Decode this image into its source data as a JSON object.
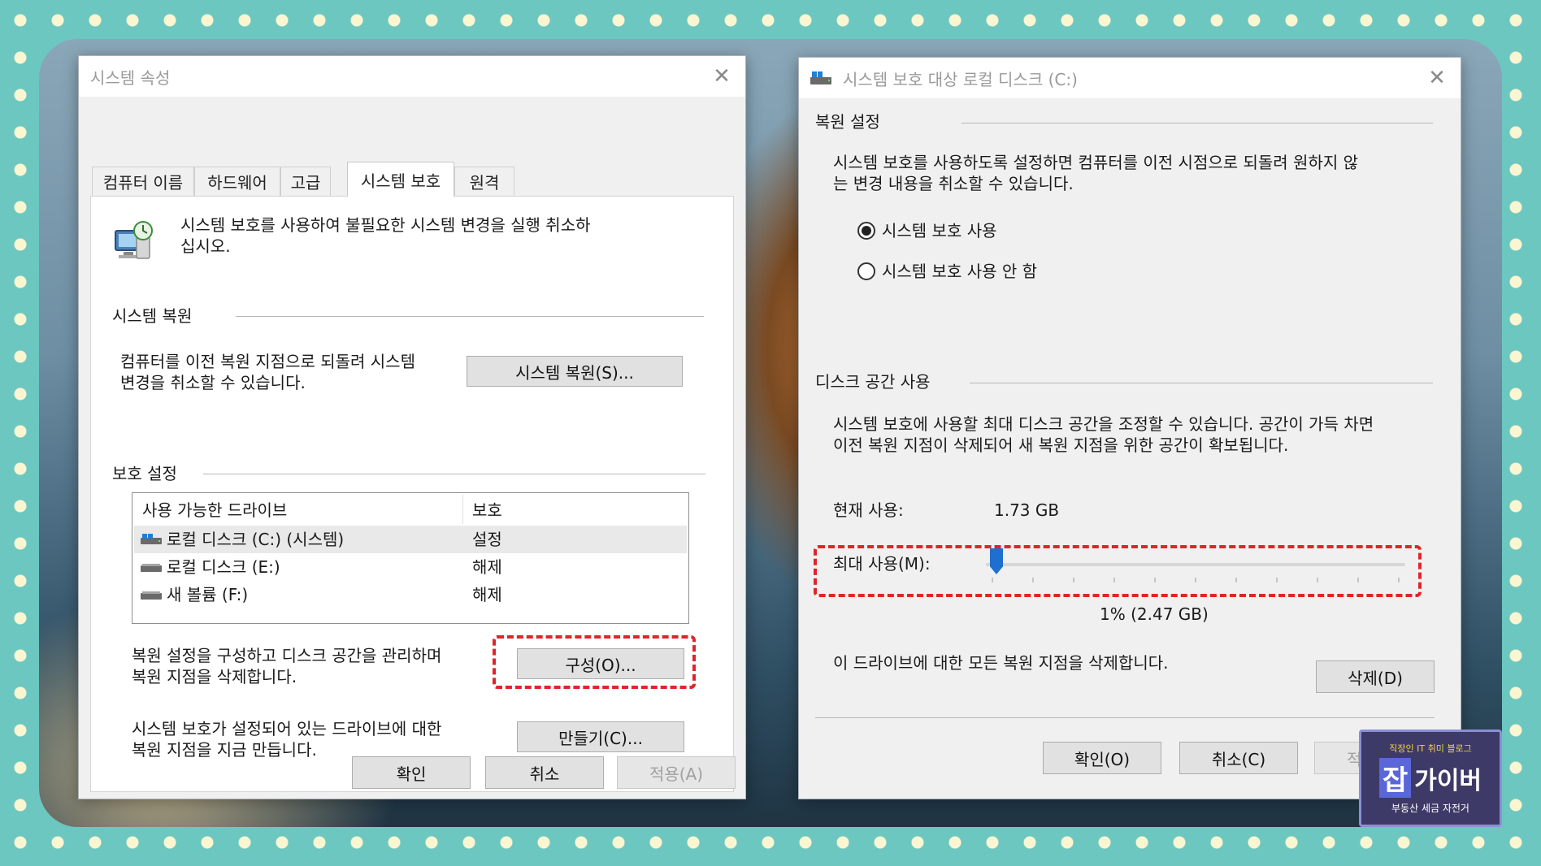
{
  "left_dialog": {
    "title": "시스템 속성",
    "tabs": [
      "컴퓨터 이름",
      "하드웨어",
      "고급",
      "시스템 보호",
      "원격"
    ],
    "active_tab": "시스템 보호",
    "intro_line1": "시스템 보호를 사용하여 불필요한 시스템 변경을 실행 취소하",
    "intro_line2": "십시오.",
    "restore_section": "시스템 복원",
    "restore_desc_line1": "컴퓨터를 이전 복원 지점으로 되돌려 시스템",
    "restore_desc_line2": "변경을 취소할 수 있습니다.",
    "restore_button": "시스템 복원(S)...",
    "protection_section": "보호 설정",
    "table_headers": [
      "사용 가능한 드라이브",
      "보호"
    ],
    "drives": [
      {
        "name": "로컬 디스크 (C:) (시스템)",
        "status": "설정"
      },
      {
        "name": "로컬 디스크 (E:)",
        "status": "해제"
      },
      {
        "name": "새 볼륨 (F:)",
        "status": "해제"
      }
    ],
    "configure_desc_line1": "복원 설정을 구성하고 디스크 공간을 관리하며",
    "configure_desc_line2": "복원 지점을 삭제합니다.",
    "configure_button": "구성(O)...",
    "create_desc_line1": "시스템 보호가 설정되어 있는 드라이브에 대한",
    "create_desc_line2": "복원 지점을 지금 만듭니다.",
    "create_button": "만들기(C)...",
    "ok_button": "확인",
    "cancel_button": "취소",
    "apply_button": "적용(A)"
  },
  "right_dialog": {
    "title": "시스템 보호 대상 로컬 디스크 (C:)",
    "restore_settings_section": "복원 설정",
    "restore_settings_desc_line1": "시스템 보호를 사용하도록 설정하면 컴퓨터를 이전 시점으로 되돌려 원하지 않",
    "restore_settings_desc_line2": "는 변경 내용을 취소할 수 있습니다.",
    "radio_on_label": "시스템 보호 사용",
    "radio_off_label": "시스템 보호 사용 안 함",
    "radio_selected": "on",
    "disk_usage_section": "디스크 공간 사용",
    "disk_usage_desc_line1": "시스템 보호에 사용할 최대 디스크 공간을 조정할 수 있습니다. 공간이 가득 차면",
    "disk_usage_desc_line2": "이전 복원 지점이 삭제되어 새 복원 지점을 위한 공간이 확보됩니다.",
    "current_usage_label": "현재 사용:",
    "current_usage_value": "1.73 GB",
    "max_usage_label": "최대 사용(M):",
    "max_usage_percent": 1,
    "max_usage_value_text": "1% (2.47 GB)",
    "delete_desc": "이 드라이브에 대한 모든 복원 지점을 삭제합니다.",
    "delete_button": "삭제(D)",
    "ok_button": "확인(O)",
    "cancel_button": "취소(C)",
    "apply_button": "적용(A)"
  },
  "watermark": {
    "top_text": "직장인 IT 취미 블로그",
    "main_text_a": "잡",
    "main_text_b": "가이버",
    "bottom_text": "부동산 세금 자전거"
  },
  "colors": {
    "highlight_border": "#e0242a",
    "slider_thumb": "#1f6fd1",
    "background_teal": "#6cc7c0",
    "dots": "#fbf6d2"
  }
}
